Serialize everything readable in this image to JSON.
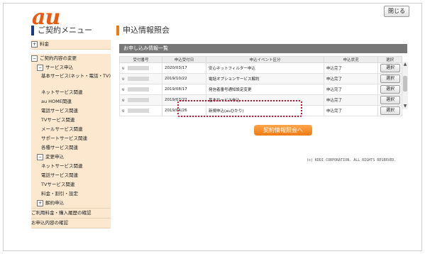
{
  "header": {
    "logo_text": "au",
    "close_label": "閉じる",
    "brand_color": "#ea5a10"
  },
  "sidebar": {
    "heading": "ご契約メニュー",
    "items": [
      {
        "label": "料金",
        "box": "+"
      },
      {
        "label": "ご契約内容の変更",
        "box": "−"
      },
      {
        "label": "サービス申込",
        "box": "−"
      },
      {
        "label": "基本サービス(ネット・電話・TV)"
      },
      {
        "label": "ネットサービス関連"
      },
      {
        "label": "au HOME関連"
      },
      {
        "label": "電話サービス関連"
      },
      {
        "label": "TVサービス関連"
      },
      {
        "label": "メールサービス関連"
      },
      {
        "label": "サポートサービス関連"
      },
      {
        "label": "各種サービス関連"
      },
      {
        "label": "変更申込",
        "box": "−"
      },
      {
        "label": "ネットサービス関連"
      },
      {
        "label": "電話サービス関連"
      },
      {
        "label": "TVサービス関連"
      },
      {
        "label": "料金・割引・設定"
      },
      {
        "label": "解約申込",
        "box": "+"
      },
      {
        "label": "ご利用料金・購入履歴の確認"
      },
      {
        "label": "お申込内容の確認"
      }
    ]
  },
  "main": {
    "heading": "申込情報照会",
    "table_title": "お申し込み情報一覧",
    "columns": [
      "受付番号",
      "申込受付日",
      "申込イベント区分",
      "申込状況",
      "選択"
    ],
    "rows": [
      {
        "id_prefix": "u",
        "date": "2020/03/17",
        "event": "安心ネットフィルター申込",
        "status": "申込完了",
        "action": "選択"
      },
      {
        "id_prefix": "u",
        "date": "2019/10/22",
        "event": "電話オプションサービス解約",
        "status": "申込完了",
        "action": "選択"
      },
      {
        "id_prefix": "u",
        "date": "2019/08/17",
        "event": "発信者番号通知設定変更",
        "status": "申込完了",
        "action": "選択"
      },
      {
        "id_prefix": "u",
        "date": "2019/07/22",
        "event": "基本サービス申込",
        "status": "申込完了",
        "action": "選択"
      },
      {
        "id_prefix": "u",
        "date": "2019/04/26",
        "event": "新規申込(auひかり)",
        "status": "申込完了",
        "action": "選択"
      }
    ],
    "contract_button": "契約情報照会へ",
    "copyright": "(c) KDDI CORPORATION. ALL RIGHTS RESERVED."
  },
  "colors": {
    "accent_orange": "#f07a14",
    "nav_blue": "#1a3a85",
    "highlight_red": "#c0102a"
  }
}
